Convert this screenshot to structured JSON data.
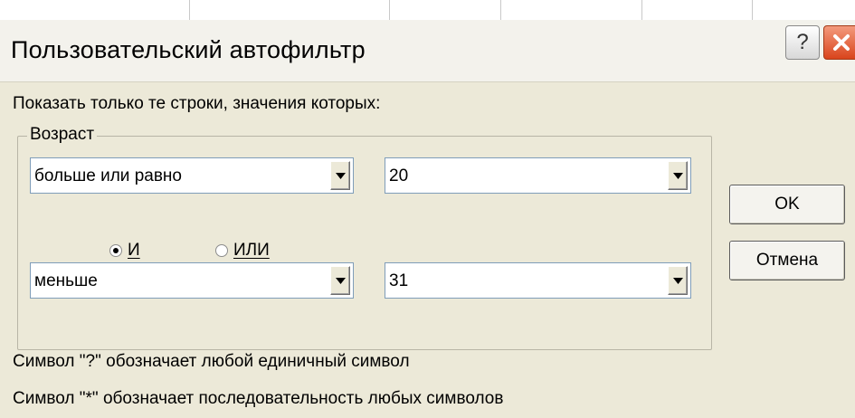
{
  "dialog": {
    "title": "Пользовательский автофильтр",
    "help_label": "?",
    "instruction": "Показать только те строки, значения которых:",
    "group_label": "Возраст",
    "condition1": {
      "operator": "больше или равно",
      "value": "20"
    },
    "logic": {
      "and_label": "И",
      "or_label": "ИЛИ",
      "selected": "and"
    },
    "condition2": {
      "operator": "меньше",
      "value": "31"
    },
    "ok_label": "OK",
    "cancel_label": "Отмена",
    "hint1": "Символ \"?\" обозначает любой единичный символ",
    "hint2": "Символ \"*\" обозначает последовательность любых символов"
  },
  "icons": {
    "help": "help-icon",
    "close": "close-icon",
    "dropdown": "chevron-down-icon"
  },
  "colors": {
    "dialog_bg": "#ece9d8",
    "close_button": "#d9441c",
    "field_border": "#7f9db9"
  }
}
